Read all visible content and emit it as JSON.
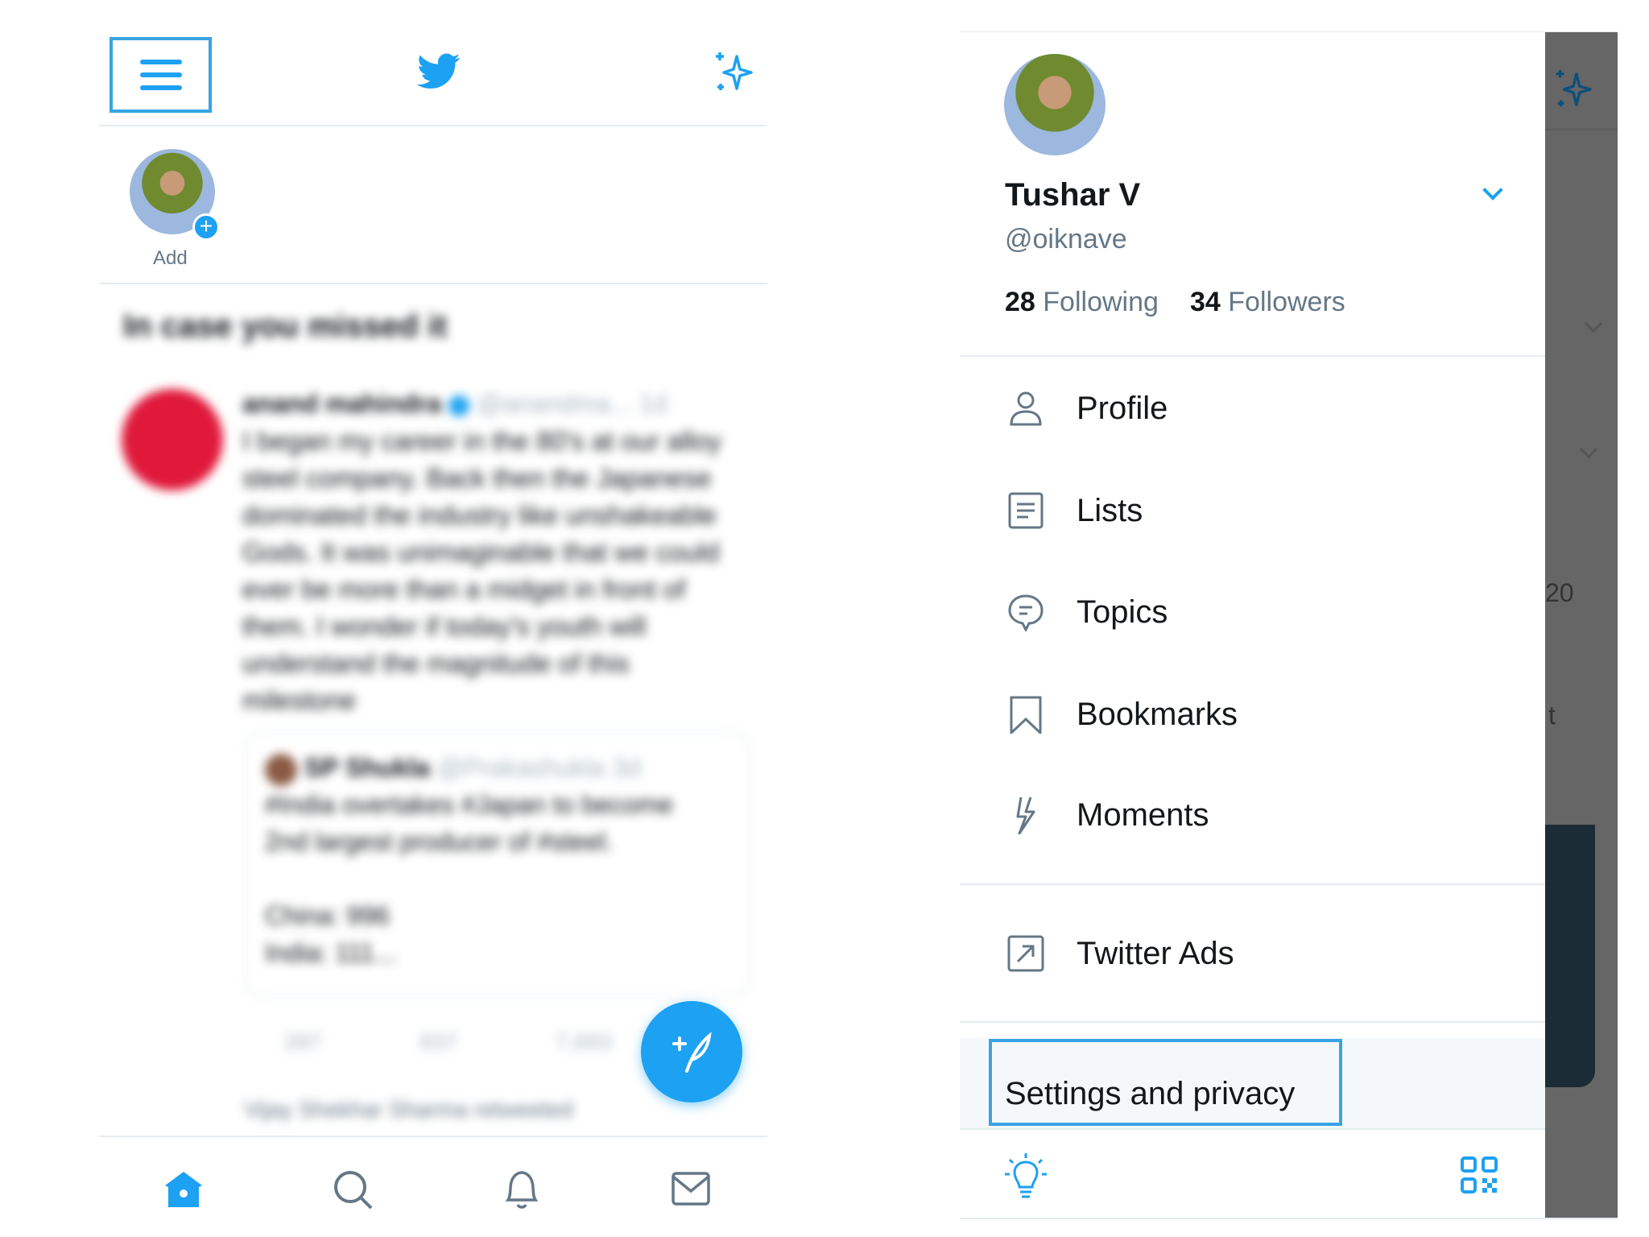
{
  "colors": {
    "accent": "#1da1f2",
    "text": "#14171a",
    "secondary": "#657786",
    "overlay": "#666666"
  },
  "left": {
    "header": {
      "menu_icon": "hamburger-icon",
      "logo": "twitter-bird-icon",
      "sparkle": "sparkle-icon"
    },
    "story": {
      "label": "Add"
    },
    "feed": {
      "section_title": "In case you missed it",
      "tweet": {
        "author": "anand mahindra",
        "handle": "@anandma...",
        "time": "1d",
        "text": [
          "I began my career in the 80's at our alloy",
          "steel company. Back then the Japanese",
          "dominated the industry like unshakeable",
          "Gods. It was unimaginable that we could",
          "ever be more than a midget in front of",
          "them. I wonder if today's youth will",
          "understand the magnitude of this",
          "milestone"
        ],
        "quote": {
          "author": "SP Shukla",
          "handle": "@Prakashukla",
          "time": "3d",
          "text": [
            "#India overtakes #Japan to become",
            "2nd largest producer of #steel."
          ],
          "data": [
            "China: 996",
            "India:    111..."
          ]
        },
        "counts": {
          "replies": "287",
          "retweets": "837",
          "likes": "7,693"
        }
      },
      "retweeted_by": "Vijay Shekhar Sharma retweeted"
    },
    "nav": [
      "home-icon",
      "search-icon",
      "notifications-icon",
      "messages-icon"
    ]
  },
  "drawer": {
    "name": "Tushar V",
    "handle": "@oiknave",
    "following_count": "28",
    "following_label": "Following",
    "followers_count": "34",
    "followers_label": "Followers",
    "menu": [
      {
        "label": "Profile",
        "icon": "person-icon"
      },
      {
        "label": "Lists",
        "icon": "lists-icon"
      },
      {
        "label": "Topics",
        "icon": "topics-icon"
      },
      {
        "label": "Bookmarks",
        "icon": "bookmark-icon"
      },
      {
        "label": "Moments",
        "icon": "lightning-icon"
      }
    ],
    "twitter_ads": "Twitter Ads",
    "settings": "Settings and privacy"
  },
  "overlay": {
    "peek_text_1": "20",
    "peek_text_2": "t"
  }
}
